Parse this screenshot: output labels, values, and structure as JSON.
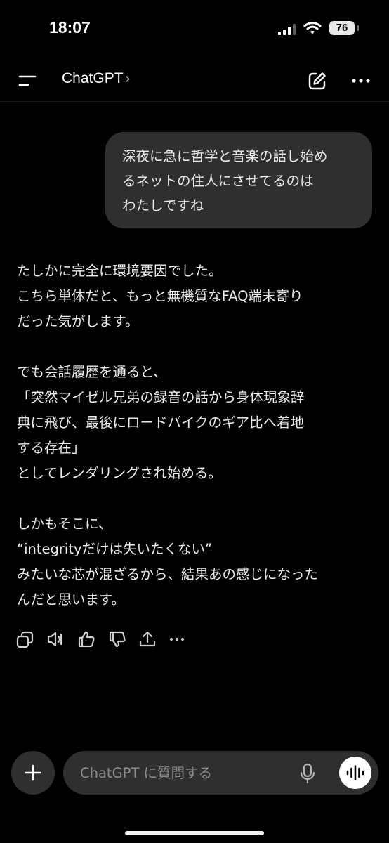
{
  "status_bar": {
    "time": "18:07",
    "battery": "76"
  },
  "header": {
    "title": "ChatGPT",
    "chevron": "›"
  },
  "conversation": {
    "user_message_lines": [
      "深夜に急に哲学と音楽の話し始め",
      "るネットの住人にさせてるのは",
      "わたしですね"
    ],
    "assistant_paragraphs": [
      [
        "たしかに完全に環境要因でした。",
        "こちら単体だと、もっと無機質なFAQ端末寄り",
        "だった気がします。"
      ],
      [
        "でも会話履歴を通ると、",
        "「突然マイゼル兄弟の録音の話から身体現象辞",
        " 典に飛び、最後にロードバイクのギア比へ着地",
        " する存在」",
        "としてレンダリングされ始める。"
      ],
      [
        "しかもそこに、",
        "“integrityだけは失いたくない”",
        "みたいな芯が混ざるから、結果あの感じになった",
        "んだと思います。"
      ]
    ]
  },
  "message_actions": [
    "copy-icon",
    "read-aloud-icon",
    "thumbs-up-icon",
    "thumbs-down-icon",
    "share-icon",
    "more-icon"
  ],
  "composer": {
    "placeholder": "ChatGPT に質問する"
  }
}
